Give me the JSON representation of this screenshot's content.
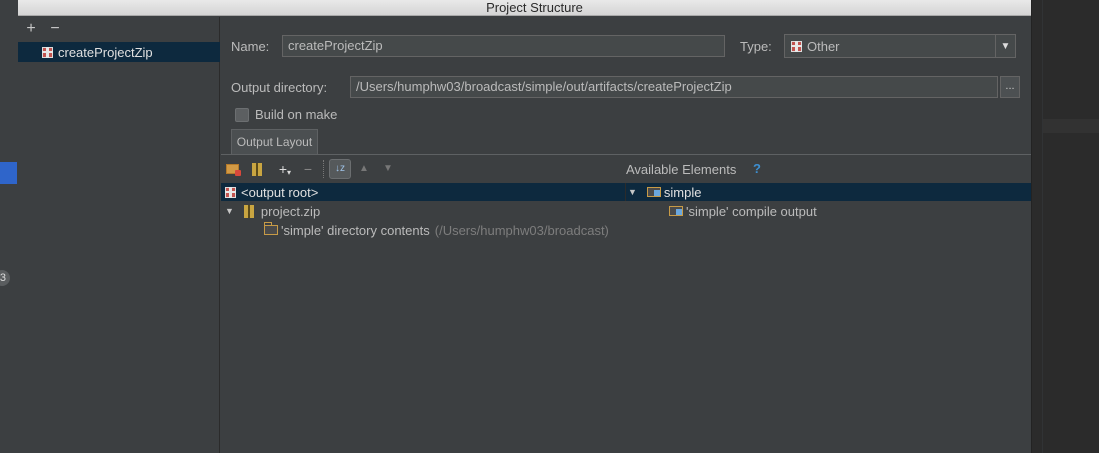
{
  "window": {
    "title": "Project Structure"
  },
  "background": {
    "badge": "3"
  },
  "left_pane": {
    "add_label": "+",
    "remove_label": "−",
    "items": [
      {
        "label": "createProjectZip",
        "icon": "gift-artifact-icon"
      }
    ]
  },
  "form": {
    "name_label": "Name:",
    "name_value": "createProjectZip",
    "type_label": "Type:",
    "type_value": "Other",
    "output_dir_label": "Output directory:",
    "output_dir_value": "/Users/humphw03/broadcast/simple/out/artifacts/createProjectZip",
    "browse_label": "...",
    "build_on_make_label": "Build on make",
    "build_on_make_checked": false
  },
  "tabs": [
    {
      "label": "Output Layout",
      "selected": true
    }
  ],
  "layout_tree": {
    "rows": [
      {
        "label": "<output root>",
        "icon": "gift-artifact-icon",
        "selected": true
      },
      {
        "label": "project.zip",
        "icon": "zip-archive-icon",
        "expanded": true
      },
      {
        "label": "'simple' directory contents",
        "suffix": "(/Users/humphw03/broadcast)",
        "icon": "folder-icon"
      }
    ]
  },
  "available": {
    "title": "Available Elements",
    "help": "?",
    "rows": [
      {
        "label": "simple",
        "icon": "module-folder-icon",
        "expanded": true
      },
      {
        "label": "'simple' compile output",
        "icon": "module-output-icon"
      }
    ]
  },
  "colors": {
    "selection": "#0d293e",
    "panel": "#3c3f41",
    "accent_help": "#3d8fd1"
  }
}
